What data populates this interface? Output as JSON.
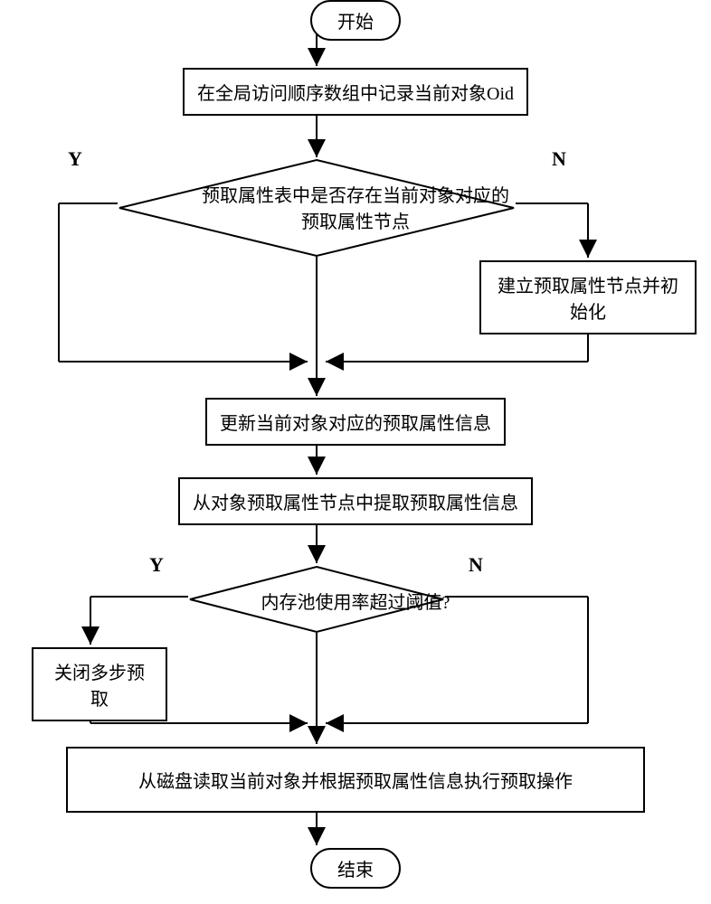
{
  "flow": {
    "start": "开始",
    "end": "结束",
    "step1": "在全局访问顺序数组中记录当前对象Oid",
    "decision1_line1": "预取属性表中是否存在当前对象对应的",
    "decision1_line2": "预取属性节点",
    "step2": "建立预取属性节点并初始化",
    "step3": "更新当前对象对应的预取属性信息",
    "step4": "从对象预取属性节点中提取预取属性信息",
    "decision2": "内存池使用率超过阈值?",
    "step5": "关闭多步预取",
    "step6": "从磁盘读取当前对象并根据预取属性信息执行预取操作"
  },
  "labels": {
    "yes": "Y",
    "no": "N"
  }
}
